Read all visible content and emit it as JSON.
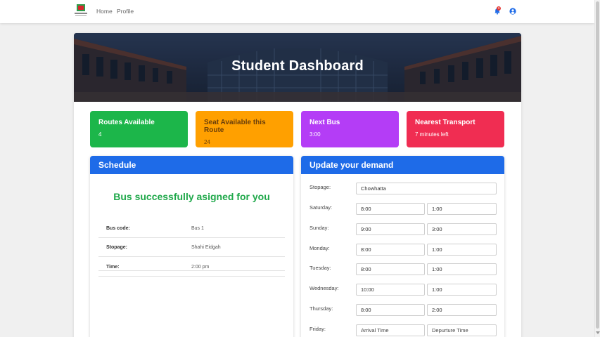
{
  "nav": {
    "home": "Home",
    "profile": "Profile",
    "notification_count": "3"
  },
  "banner": {
    "title": "Student Dashboard"
  },
  "stats": [
    {
      "title": "Routes Available",
      "value": "4",
      "color": "#1cb64a"
    },
    {
      "title": "Seat Available this Route",
      "value": "24",
      "color": "#ffa000"
    },
    {
      "title": "Next Bus",
      "value": "3:00",
      "color": "#b43df6"
    },
    {
      "title": "Nearest Transport",
      "value": "7 minutes left",
      "color": "#f02d52"
    }
  ],
  "schedule": {
    "title": "Schedule",
    "message": "Bus successfully asigned for you",
    "rows": [
      {
        "label": "Bus code:",
        "value": "Bus 1"
      },
      {
        "label": "Stopage:",
        "value": "Shahi Eidgah"
      },
      {
        "label": "Time:",
        "value": "2:00 pm"
      }
    ]
  },
  "demand": {
    "title": "Update your demand",
    "stopage_label": "Stopage:",
    "stopage_value": "Chowhatta",
    "days": [
      {
        "label": "Saturday:",
        "arrival": "8:00",
        "departure": "1:00"
      },
      {
        "label": "Sunday:",
        "arrival": "9:00",
        "departure": "3:00"
      },
      {
        "label": "Monday:",
        "arrival": "8:00",
        "departure": "1:00"
      },
      {
        "label": "Tuesday:",
        "arrival": "8:00",
        "departure": "1:00"
      },
      {
        "label": "Wednesday:",
        "arrival": "10:00",
        "departure": "1:00"
      },
      {
        "label": "Thursday:",
        "arrival": "8:00",
        "departure": "2:00"
      },
      {
        "label": "Friday:",
        "arrival": "",
        "departure": "",
        "arrival_placeholder": "Arrival Time",
        "departure_placeholder": "Depurture Time"
      }
    ]
  },
  "colors": {
    "primary": "#1e6be8",
    "success_text": "#1fa84a"
  }
}
